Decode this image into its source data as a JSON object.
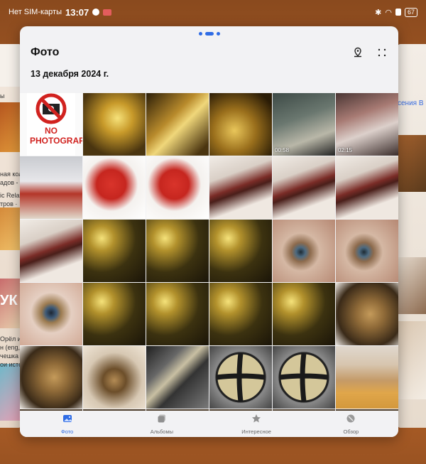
{
  "status_bar": {
    "carrier": "Нет SIM-карты",
    "time": "13:07",
    "battery": "67"
  },
  "app": {
    "title": "Фото",
    "date_header": "13 декабря 2024 г."
  },
  "side_left": {
    "lines": [
      "ы",
      "ная кол",
      "адов -",
      "ic Relax",
      "тров ·",
      "УК",
      "Орёл и Ре",
      "н (eng,",
      "чешка ·",
      "ои истор"
    ]
  },
  "side_right": {
    "tab": "сения  В"
  },
  "photos": [
    {
      "kind": "no-photo-sign",
      "sign_text": "NO PHOTOGRAPHY"
    },
    {
      "kind": "gold1"
    },
    {
      "kind": "gold2"
    },
    {
      "kind": "gold3"
    },
    {
      "kind": "mono",
      "duration": "00:58"
    },
    {
      "kind": "mono2",
      "duration": "02:15"
    },
    {
      "kind": "clown"
    },
    {
      "kind": "lips"
    },
    {
      "kind": "lips"
    },
    {
      "kind": "leaf"
    },
    {
      "kind": "leaf"
    },
    {
      "kind": "leaf"
    },
    {
      "kind": "leaf"
    },
    {
      "kind": "bokeh"
    },
    {
      "kind": "bokeh"
    },
    {
      "kind": "bokeh"
    },
    {
      "kind": "eye2"
    },
    {
      "kind": "eye2"
    },
    {
      "kind": "eye"
    },
    {
      "kind": "bokeh"
    },
    {
      "kind": "bokeh"
    },
    {
      "kind": "bokeh"
    },
    {
      "kind": "bokeh"
    },
    {
      "kind": "pod"
    },
    {
      "kind": "pod"
    },
    {
      "kind": "pod2"
    },
    {
      "kind": "grey"
    },
    {
      "kind": "button"
    },
    {
      "kind": "button"
    },
    {
      "kind": "man"
    },
    {
      "kind": "row"
    },
    {
      "kind": "row"
    },
    {
      "kind": "row"
    },
    {
      "kind": "row"
    },
    {
      "kind": "row"
    },
    {
      "kind": "row"
    }
  ],
  "nav": {
    "items": [
      {
        "label": "Фото",
        "icon": "photo-icon",
        "active": true
      },
      {
        "label": "Альбомы",
        "icon": "albums-icon",
        "active": false
      },
      {
        "label": "Интересное",
        "icon": "star-icon",
        "active": false
      },
      {
        "label": "Обзор",
        "icon": "discover-icon",
        "active": false
      }
    ]
  },
  "colors": {
    "accent": "#2f6ce5",
    "background": "#b5622a",
    "window": "#f2f2f4"
  }
}
